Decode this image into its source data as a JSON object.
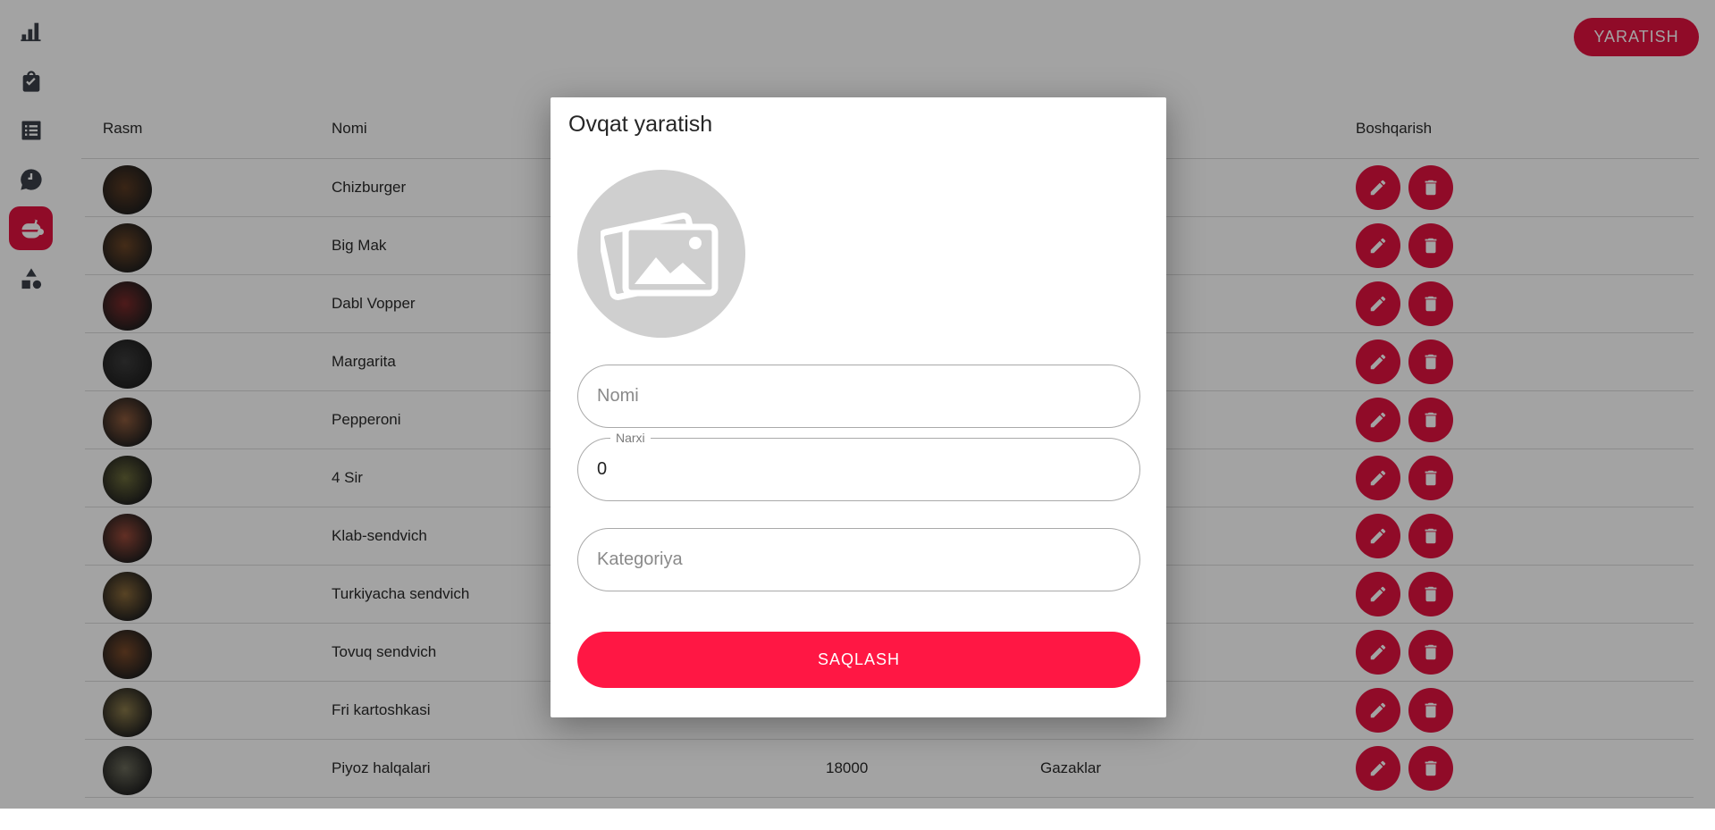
{
  "header": {
    "create_label": "YARATISH"
  },
  "sidebar": {
    "items": [
      {
        "icon": "bar-chart-icon",
        "active": false
      },
      {
        "icon": "shopping-bag-icon",
        "active": false
      },
      {
        "icon": "list-icon",
        "active": false
      },
      {
        "icon": "chat-clock-icon",
        "active": false
      },
      {
        "icon": "food-icon",
        "active": true
      },
      {
        "icon": "categories-icon",
        "active": false
      }
    ]
  },
  "table": {
    "columns": [
      "Rasm",
      "Nomi",
      "Boshqarish"
    ],
    "rows": [
      {
        "name": "Chizburger",
        "price": "",
        "category": "",
        "img_color": "#5a3a22"
      },
      {
        "name": "Big Mak",
        "price": "",
        "category": "",
        "img_color": "#6b4526"
      },
      {
        "name": "Dabl Vopper",
        "price": "",
        "category": "",
        "img_color": "#7a2a2a"
      },
      {
        "name": "Margarita",
        "price": "",
        "category": "",
        "img_color": "#3b3b3b"
      },
      {
        "name": "Pepperoni",
        "price": "",
        "category": "",
        "img_color": "#8c5a3c"
      },
      {
        "name": "4 Sir",
        "price": "",
        "category": "",
        "img_color": "#6a6a3a"
      },
      {
        "name": "Klab-sendvich",
        "price": "",
        "category": "",
        "img_color": "#9a4a3a"
      },
      {
        "name": "Turkiyacha sendvich",
        "price": "",
        "category": "",
        "img_color": "#8a6a3a"
      },
      {
        "name": "Tovuq sendvich",
        "price": "",
        "category": "",
        "img_color": "#7a4a2a"
      },
      {
        "name": "Fri kartoshkasi",
        "price": "",
        "category": "",
        "img_color": "#8a7a4a"
      },
      {
        "name": "Piyoz halqalari",
        "price": "18000",
        "category": "Gazaklar",
        "img_color": "#6a6a5a"
      }
    ]
  },
  "modal": {
    "title": "Ovqat yaratish",
    "image_icon": "image-placeholder-icon",
    "name_placeholder": "Nomi",
    "price_label": "Narxi",
    "price_value": "0",
    "category_placeholder": "Kategoriya",
    "save_label": "SAQLASH"
  },
  "colors": {
    "accent": "#e2123f",
    "save": "#ff1744"
  }
}
